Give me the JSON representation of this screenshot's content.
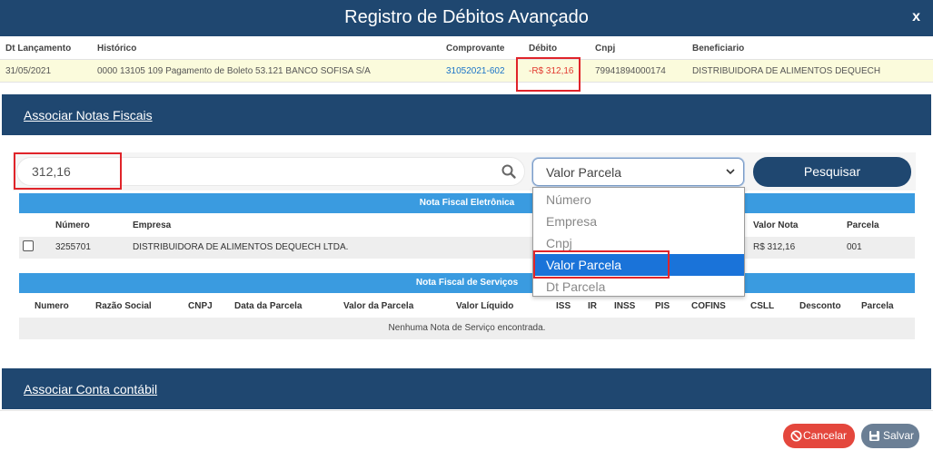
{
  "window": {
    "title": "Registro de Débitos Avançado",
    "close_label": "x"
  },
  "debit_table": {
    "columns": [
      "Dt Lançamento",
      "Histórico",
      "Comprovante",
      "Débito",
      "Cnpj",
      "Beneficiario"
    ],
    "row": {
      "date": "31/05/2021",
      "historico": "0000 13105 109 Pagamento de Boleto 53.121 BANCO SOFISA S/A",
      "comprovante": "31052021-602",
      "debito": "-R$ 312,16",
      "cnpj": "79941894000174",
      "beneficiario": "DISTRIBUIDORA DE ALIMENTOS DEQUECH"
    }
  },
  "associar_notas": {
    "label": "Associar Notas Fiscais"
  },
  "search": {
    "value": "312,16",
    "icon": "search-icon",
    "filter_selected": "Valor Parcela",
    "filter_options": [
      "Número",
      "Empresa",
      "Cnpj",
      "Valor Parcela",
      "Dt Parcela"
    ],
    "button_label": "Pesquisar"
  },
  "nfe": {
    "title": "Nota Fiscal Eletrônica",
    "columns": {
      "numero": "Número",
      "empresa": "Empresa",
      "valor_nota": "Valor Nota",
      "parcela": "Parcela"
    },
    "rows": [
      {
        "numero": "3255701",
        "empresa": "DISTRIBUIDORA DE ALIMENTOS DEQUECH LTDA.",
        "valor_nota": "R$ 312,16",
        "parcela": "001"
      }
    ]
  },
  "nfs": {
    "title": "Nota Fiscal de Serviços",
    "columns": [
      "Numero",
      "Razão Social",
      "CNPJ",
      "Data da Parcela",
      "Valor da Parcela",
      "Valor Líquido",
      "ISS",
      "IR",
      "INSS",
      "PIS",
      "COFINS",
      "CSLL",
      "Desconto",
      "Parcela"
    ],
    "empty_message": "Nenhuma Nota de Serviço encontrada."
  },
  "associar_conta": {
    "label": "Associar Conta contábil"
  },
  "footer": {
    "cancel_label": "Cancelar",
    "save_label": "Salvar",
    "cancel_color": "#e4473d",
    "save_color": "#6b7f95"
  },
  "colors": {
    "header": "#1f4770",
    "section": "#3a9be0",
    "highlight_row": "#fbfbdc",
    "negative": "#e23a30",
    "selected_option": "#1a73d9"
  }
}
